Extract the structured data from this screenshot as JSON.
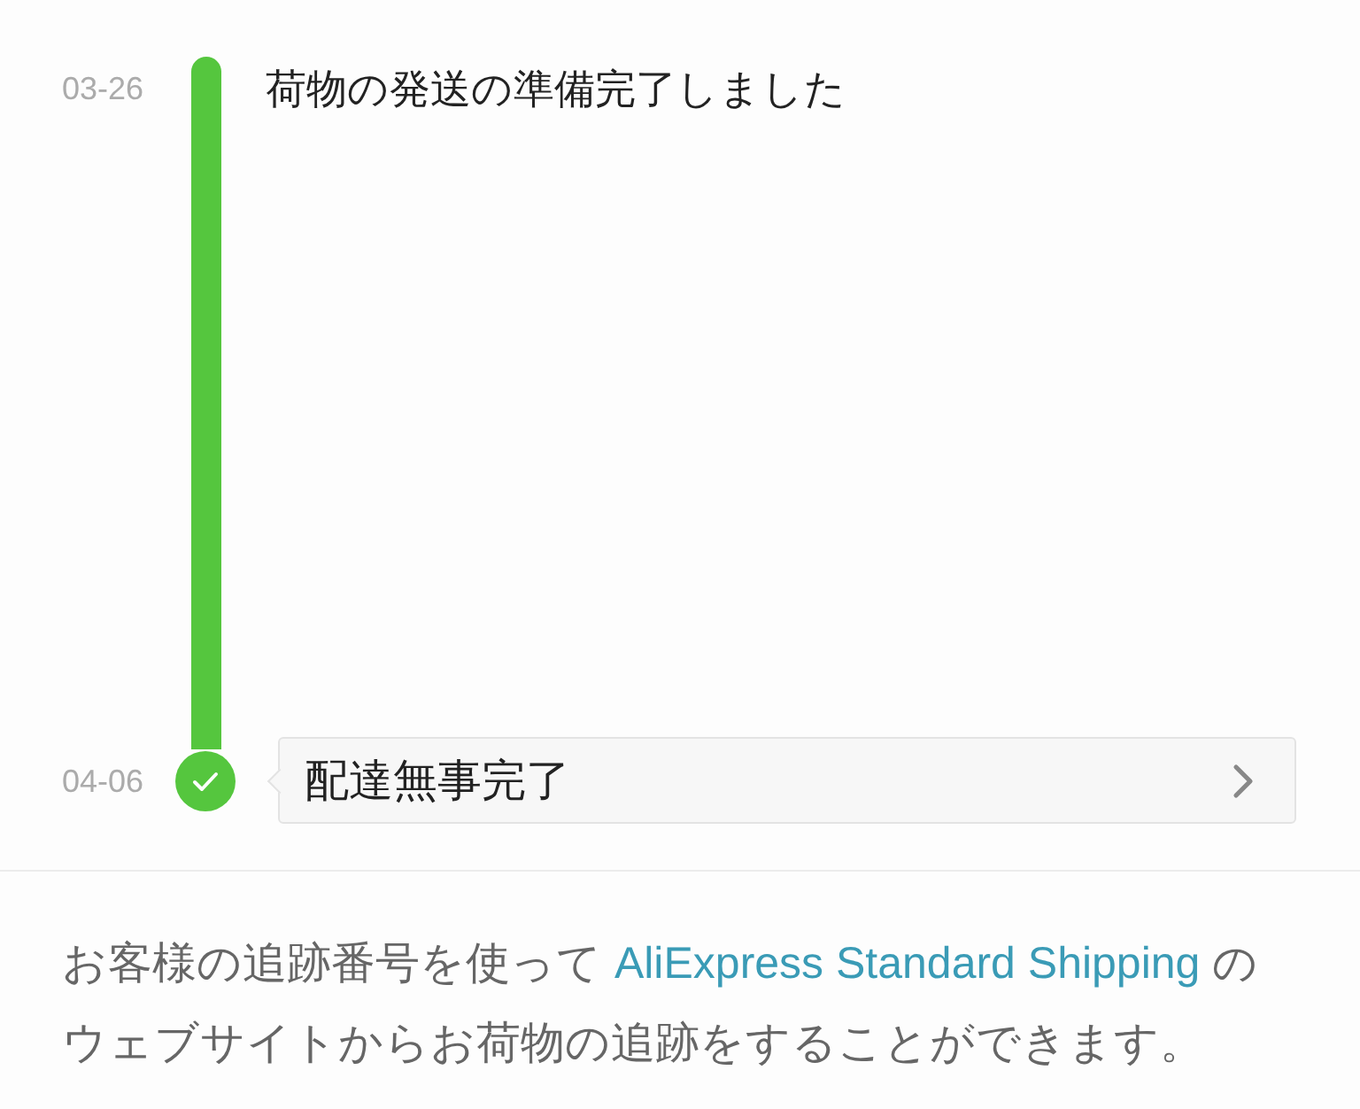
{
  "timeline": [
    {
      "kind": "progress",
      "date": "03-26",
      "title": "荷物の発送の準備完了しました"
    },
    {
      "kind": "delivered",
      "date": "04-06",
      "title": "配達無事完了"
    }
  ],
  "tracking_note": {
    "before": "お客様の追跡番号を使って ",
    "link": "AliExpress Standard Shipping",
    "after": " のウェブサイトからお荷物の追跡をすることができます。"
  }
}
